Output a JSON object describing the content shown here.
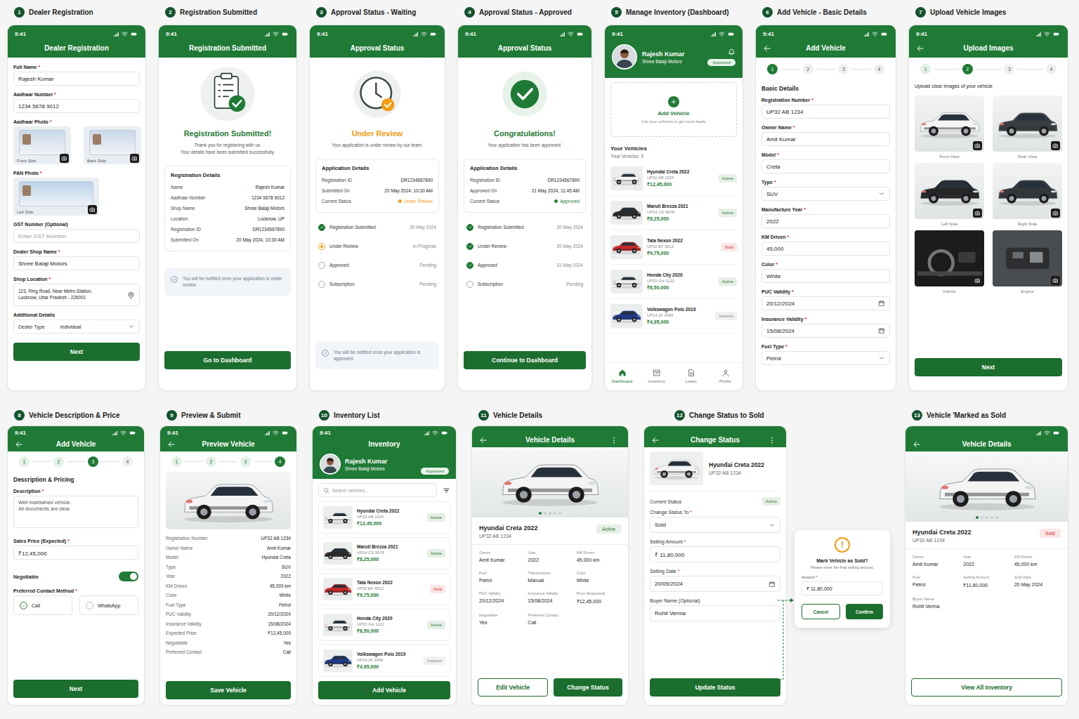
{
  "status_time": "9:41",
  "screens": [
    {
      "number": "1",
      "title": "Dealer Registration"
    },
    {
      "number": "2",
      "title": "Registration Submitted"
    },
    {
      "number": "3",
      "title": "Approval Status - Waiting"
    },
    {
      "number": "4",
      "title": "Approval Status - Approved"
    },
    {
      "number": "5",
      "title": "Manage Inventory (Dashboard)"
    },
    {
      "number": "6",
      "title": "Add Vehicle - Basic Details"
    },
    {
      "number": "7",
      "title": "Upload Vehicle Images"
    },
    {
      "number": "8",
      "title": "Vehicle Description & Price"
    },
    {
      "number": "9",
      "title": "Preview & Submit"
    },
    {
      "number": "10",
      "title": "Inventory List"
    },
    {
      "number": "11",
      "title": "Vehicle Details"
    },
    {
      "number": "12",
      "title": "Change Status to Sold"
    },
    {
      "number": "13",
      "title": "Vehicle 'Marked as Sold"
    }
  ],
  "dealer": {
    "name": "Rajesh Kumar",
    "shop": "Shree Balaji Motors",
    "badge": "Approved"
  },
  "vehicles": [
    {
      "name": "Hyundai Creta 2022",
      "reg": "UP32 AB 1234",
      "price": "₹12,45,000",
      "status": "Active",
      "color": "#2e7d32",
      "car_color": "#f4f4f4"
    },
    {
      "name": "Maruti Brezza 2021",
      "reg": "UP14 CD 5678",
      "price": "₹8,25,000",
      "status": "Active",
      "color": "#2e7d32",
      "car_color": "#2a2a2a"
    },
    {
      "name": "Tata Nexon 2022",
      "reg": "UP32 EF 9012",
      "price": "₹9,75,000",
      "status": "Sold",
      "color": "#d32f2f",
      "car_color": "#c62828"
    },
    {
      "name": "Honda City 2020",
      "reg": "UP32 GH 1122",
      "price": "₹6,50,000",
      "status": "Active",
      "color": "#2e7d32",
      "car_color": "#f0f0f0"
    },
    {
      "name": "Volkswagen Polo 2019",
      "reg": "UP14 JK 3456",
      "price": "₹4,95,000",
      "status": "Inactive",
      "color": "#888888",
      "car_color": "#1e3a8a"
    }
  ],
  "registration_form": {
    "header": "Dealer Registration",
    "fields_top": [
      {
        "label": "Full Name",
        "mark": "*",
        "value": "Rajesh Kumar"
      },
      {
        "label": "Aadhaar Number",
        "mark": "*",
        "value": "1234 5678 9012"
      }
    ],
    "aadhaar_photo": {
      "label": "Aadhaar Photo",
      "mark": "*",
      "photos": [
        "Front Side",
        "Back Side"
      ]
    },
    "pan_photo": {
      "label": "PAN Photo",
      "mark": "*",
      "photos": [
        "Left Side"
      ]
    },
    "gst": {
      "label": "GST Number (Optional)",
      "placeholder": "Enter GST Number"
    },
    "shop_name": {
      "label": "Dealer Shop Name",
      "mark": "*",
      "value": "Shree Balaji Motors"
    },
    "location": {
      "label": "Shop Location",
      "mark": "*",
      "lines": [
        "123, Ring Road, Near Metro Station,",
        "Lucknow, Uttar Pradesh - 226001"
      ]
    },
    "additional": {
      "label": "Additional Details",
      "select_label": "Dealer Type",
      "value": "Individual"
    },
    "button": "Next"
  },
  "registration_submitted": {
    "header": "Registration Submitted",
    "title": "Registration Submitted!",
    "message": [
      "Thank you for registering with us.",
      "Your details have been submitted successfully."
    ],
    "card_title": "Registration Details",
    "rows": [
      {
        "label": "Name",
        "value": "Rajesh Kumar"
      },
      {
        "label": "Aadhaar Number",
        "value": "1234 5678 9012"
      },
      {
        "label": "Shop Name",
        "value": "Shree Balaji Motors"
      },
      {
        "label": "Location",
        "value": "Lucknow, UP"
      },
      {
        "label": "Registration ID",
        "value": "DR1234567890"
      },
      {
        "label": "Submitted On",
        "value": "20 May 2024, 10:30 AM"
      }
    ],
    "note": "You will be notified once your application is under review.",
    "button": "Go to Dashboard"
  },
  "approval_waiting": {
    "header": "Approval Status",
    "title": "Under Review",
    "message": "Your application is under review by our team.",
    "card_title": "Application Details",
    "rows": [
      {
        "label": "Registration ID",
        "value": "DR1234567890"
      },
      {
        "label": "Submitted On",
        "value": "20 May 2024, 10:30 AM"
      }
    ],
    "status": {
      "label": "Current Status",
      "value": "Under Review",
      "color": "#f39c12"
    },
    "timeline": [
      {
        "label": "Registration Submitted",
        "date": "20 May 2024",
        "kind": "done"
      },
      {
        "label": "Under Review",
        "date": "In Progress",
        "kind": "current"
      },
      {
        "label": "Approved",
        "date": "Pending",
        "kind": "pending"
      },
      {
        "label": "Subscription",
        "date": "Pending",
        "kind": "pending"
      }
    ],
    "note": "You will be notified once your application is approved."
  },
  "approval_approved": {
    "header": "Approval Status",
    "title": "Congratulations!",
    "message": "Your application has been approved.",
    "card_title": "Application Details",
    "rows": [
      {
        "label": "Registration ID",
        "value": "DR1234567890"
      },
      {
        "label": "Approved On",
        "value": "21 May 2024, 11:45 AM"
      }
    ],
    "status": {
      "label": "Current Status",
      "value": "Approved",
      "color": "#2e7d32"
    },
    "timeline": [
      {
        "label": "Registration Submitted",
        "date": "20 May 2024",
        "kind": "done"
      },
      {
        "label": "Under Review",
        "date": "20 May 2024",
        "kind": "done"
      },
      {
        "label": "Approved",
        "date": "21 May 2024",
        "kind": "done"
      },
      {
        "label": "Subscription",
        "date": "Pending",
        "kind": "pending"
      }
    ],
    "button": "Continue to Dashboard"
  },
  "dashboard": {
    "add_title": "Add Vehicle",
    "add_subtitle": "List your vehicles to get more leads",
    "list_title": "Your Vehicles",
    "total": "Total Vehicles: 5",
    "nav": [
      {
        "label": "Dashboard",
        "selected": true
      },
      {
        "label": "Inventory",
        "selected": false
      },
      {
        "label": "Leads",
        "selected": false
      },
      {
        "label": "Profile",
        "selected": false
      }
    ]
  },
  "add_basic": {
    "header": "Add Vehicle",
    "steps": [
      {
        "label": "1",
        "selected": true,
        "done": false
      },
      {
        "label": "2",
        "selected": false,
        "done": false
      },
      {
        "label": "3",
        "selected": false,
        "done": false
      },
      {
        "label": "4",
        "selected": false,
        "done": false
      }
    ],
    "section": "Basic Details",
    "fields": [
      {
        "label": "Registration Number",
        "mark": "*",
        "value": "UP32 AB 1234",
        "kind": "text"
      },
      {
        "label": "Owner Name",
        "mark": "*",
        "value": "Amit Kumar",
        "kind": "text"
      },
      {
        "label": "Model",
        "mark": "*",
        "value": "Creta",
        "kind": "text"
      },
      {
        "label": "Type",
        "mark": "*",
        "value": "SUV",
        "kind": "select"
      },
      {
        "label": "Manufacture Year",
        "mark": "*",
        "value": "2022",
        "kind": "text"
      },
      {
        "label": "KM Driven",
        "mark": "*",
        "value": "45,000",
        "kind": "text"
      },
      {
        "label": "Color",
        "mark": "*",
        "value": "White",
        "kind": "text"
      },
      {
        "label": "PUC Validity",
        "mark": "*",
        "value": "20/12/2024",
        "kind": "date"
      },
      {
        "label": "Insurance Validity",
        "mark": "*",
        "value": "15/08/2024",
        "kind": "date"
      },
      {
        "label": "Fuel Type",
        "mark": "*",
        "value": "Petrol",
        "kind": "select"
      }
    ]
  },
  "upload_images": {
    "header": "Upload Images",
    "steps": [
      {
        "label": "1",
        "selected": false,
        "done": true
      },
      {
        "label": "2",
        "selected": true,
        "done": false
      },
      {
        "label": "3",
        "selected": false,
        "done": false
      },
      {
        "label": "4",
        "selected": false,
        "done": false
      }
    ],
    "hint": "Upload clear images of your vehicle",
    "images": [
      {
        "label": "Front View",
        "kind": "car",
        "color": "#f4f4f4"
      },
      {
        "label": "Rear View",
        "kind": "car",
        "color": "#3a3d40"
      },
      {
        "label": "Left Side",
        "kind": "car",
        "color": "#252628"
      },
      {
        "label": "Right Side",
        "kind": "car",
        "color": "#34373a"
      },
      {
        "label": "Interior",
        "kind": "interior",
        "color": "#1c1c1c"
      },
      {
        "label": "Engine",
        "kind": "engine",
        "color": "#4a4d50"
      }
    ],
    "button": "Next"
  },
  "add_description": {
    "header": "Add Vehicle",
    "steps": [
      {
        "label": "1",
        "selected": false,
        "done": true
      },
      {
        "label": "2",
        "selected": false,
        "done": true
      },
      {
        "label": "3",
        "selected": true,
        "done": false
      },
      {
        "label": "4",
        "selected": false,
        "done": false
      }
    ],
    "section": "Description & Pricing",
    "description": {
      "label": "Description",
      "mark": "*",
      "lines": [
        "Well maintained vehicle.",
        "All documents are clear."
      ]
    },
    "price": {
      "label": "Sales Price (Expected)",
      "mark": "*",
      "value": "₹12,45,000"
    },
    "negotiable": {
      "label": "Negotiable",
      "on": true
    },
    "contact": {
      "label": "Preferred Contact Method",
      "mark": "*",
      "options": [
        {
          "label": "Call",
          "selected": true
        },
        {
          "label": "WhatsApp",
          "selected": false
        }
      ]
    },
    "button": "Next"
  },
  "preview": {
    "header": "Preview Vehicle",
    "steps": [
      {
        "label": "1",
        "selected": false,
        "done": true
      },
      {
        "label": "2",
        "selected": false,
        "done": true
      },
      {
        "label": "3",
        "selected": false,
        "done": true
      },
      {
        "label": "4",
        "selected": true,
        "done": false
      }
    ],
    "rows": [
      {
        "label": "Registration Number",
        "value": "UP32 AB 1234"
      },
      {
        "label": "Owner Name",
        "value": "Amit Kumar"
      },
      {
        "label": "Model",
        "value": "Hyundai Creta"
      },
      {
        "label": "Type",
        "value": "SUV"
      },
      {
        "label": "Year",
        "value": "2022"
      },
      {
        "label": "KM Driven",
        "value": "45,000 km"
      },
      {
        "label": "Color",
        "value": "White"
      },
      {
        "label": "Fuel Type",
        "value": "Petrol"
      },
      {
        "label": "PUC Validity",
        "value": "20/12/2024"
      },
      {
        "label": "Insurance Validity",
        "value": "15/08/2024"
      },
      {
        "label": "Expected Price",
        "value": "₹12,45,000"
      },
      {
        "label": "Negotiable",
        "value": "Yes"
      },
      {
        "label": "Preferred Contact",
        "value": "Call"
      }
    ],
    "button": "Save Vehicle"
  },
  "inventory_list": {
    "header": "Inventory",
    "search_placeholder": "Search vehicles...",
    "button": "Add Vehicle"
  },
  "vehicle_details": {
    "header": "Vehicle Details",
    "dots": [
      {
        "selected": true
      },
      {
        "selected": false
      },
      {
        "selected": false
      },
      {
        "selected": false
      },
      {
        "selected": false
      }
    ],
    "title": "Hyundai Creta 2022",
    "reg": "UP32 AB 1234",
    "status": {
      "label": "Active",
      "color": "#2e7d32"
    },
    "specs": [
      {
        "label": "Owner",
        "value": "Amit Kumar"
      },
      {
        "label": "Year",
        "value": "2022"
      },
      {
        "label": "KM Driven",
        "value": "45,000 km"
      },
      {
        "label": "Fuel",
        "value": "Petrol"
      },
      {
        "label": "Transmission",
        "value": "Manual"
      },
      {
        "label": "Color",
        "value": "White"
      },
      {
        "label": "PUC Validity",
        "value": "20/12/2024"
      },
      {
        "label": "Insurance Validity",
        "value": "15/08/2024"
      },
      {
        "label": "Price (Expected)",
        "value": "₹12,45,000"
      },
      {
        "label": "Negotiable",
        "value": "Yes"
      },
      {
        "label": "Preferred Contact",
        "value": "Call"
      }
    ],
    "buttons": [
      {
        "label": "Edit Vehicle",
        "kind": "outline"
      },
      {
        "label": "Change Status",
        "kind": "filled"
      }
    ]
  },
  "change_status": {
    "header": "Change Status",
    "title": "Hyundai Creta 2022",
    "reg": "UP32 AB 1234",
    "current": {
      "label": "Current Status",
      "value": "Active",
      "color": "#2e7d32"
    },
    "fields": [
      {
        "label": "Change Status To",
        "mark": "*",
        "value": "Sold",
        "kind": "select"
      },
      {
        "label": "Selling Amount",
        "mark": "*",
        "value": "₹ 11,80,000",
        "kind": "text"
      },
      {
        "label": "Selling Date",
        "mark": "*",
        "value": "20/05/2024",
        "kind": "date"
      },
      {
        "label": "Buyer Name (Optional)",
        "value": "Rohit Verma",
        "kind": "text"
      }
    ],
    "button": "Update Status",
    "dialog": {
      "icon": "!",
      "title": "Mark Vehicle as Sold?",
      "message": "Please enter the final selling amount.",
      "amount_label": "Amount",
      "mark": "*",
      "amount": "₹ 11,80,000",
      "cancel": "Cancel",
      "confirm": "Confirm"
    }
  },
  "sold_details": {
    "header": "Vehicle Details",
    "dots": [
      {
        "selected": true
      },
      {
        "selected": false
      },
      {
        "selected": false
      },
      {
        "selected": false
      },
      {
        "selected": false
      }
    ],
    "title": "Hyundai Creta 2022",
    "reg": "UP32 AB 1234",
    "status": {
      "label": "Sold",
      "color": "#d32f2f"
    },
    "specs": [
      {
        "label": "Owner",
        "value": "Amit Kumar"
      },
      {
        "label": "Year",
        "value": "2022"
      },
      {
        "label": "KM Driven",
        "value": "45,000 km"
      },
      {
        "label": "Fuel",
        "value": "Petrol"
      },
      {
        "label": "Selling Amount",
        "value": "₹11,80,000"
      },
      {
        "label": "Sold Date",
        "value": "20 May 2024"
      },
      {
        "label": "Buyer Name",
        "value": "Rohit Verma"
      }
    ],
    "button": "View All Inventory"
  }
}
